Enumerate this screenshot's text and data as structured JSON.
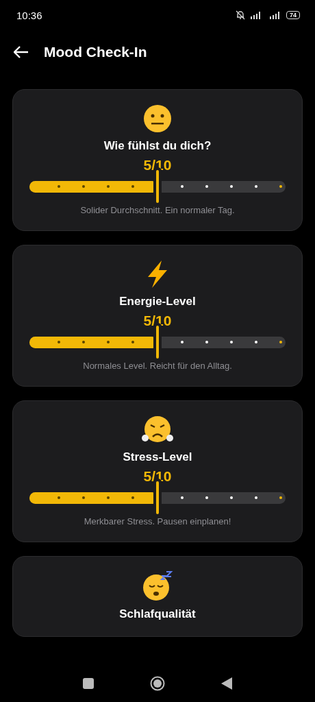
{
  "status_bar": {
    "time": "10:36",
    "battery": "74"
  },
  "header": {
    "title": "Mood Check-In"
  },
  "cards": [
    {
      "kind": "neutral",
      "title": "Wie fühlst du dich?",
      "value": "5/10",
      "level": 0.5,
      "description": "Solider Durchschnitt. Ein normaler Tag."
    },
    {
      "kind": "energy",
      "title": "Energie-Level",
      "value": "5/10",
      "level": 0.5,
      "description": "Normales Level. Reicht für den Alltag."
    },
    {
      "kind": "stress",
      "title": "Stress-Level",
      "value": "5/10",
      "level": 0.5,
      "description": "Merkbarer Stress. Pausen einplanen!"
    },
    {
      "kind": "sleep",
      "title": "Schlafqualität"
    }
  ]
}
